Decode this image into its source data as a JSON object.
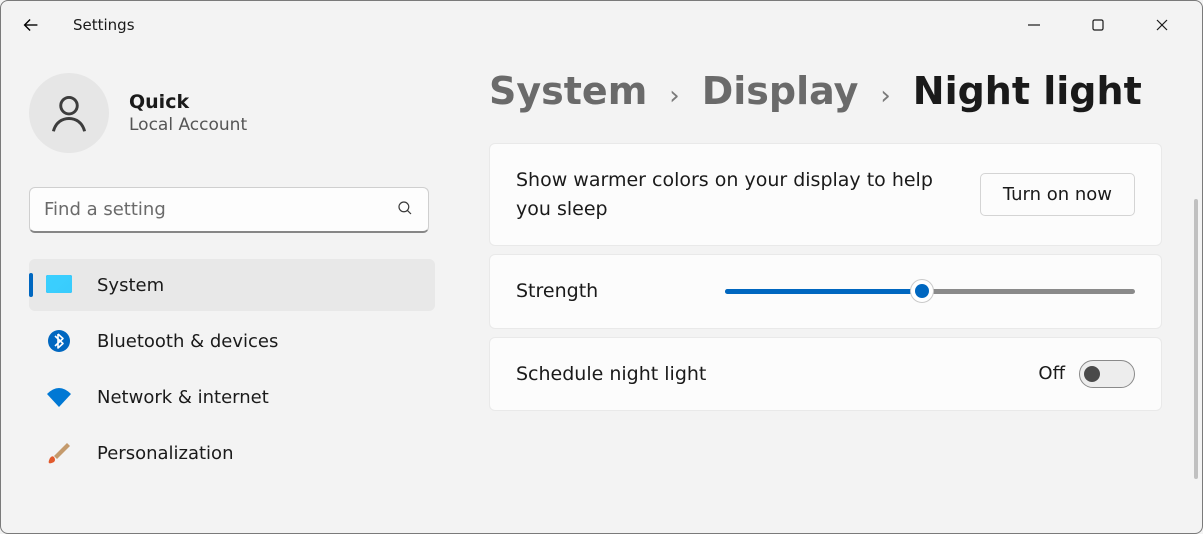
{
  "app_title": "Settings",
  "profile": {
    "name": "Quick",
    "subtitle": "Local Account"
  },
  "search": {
    "placeholder": "Find a setting"
  },
  "nav": {
    "items": [
      {
        "label": "System",
        "icon": "system"
      },
      {
        "label": "Bluetooth & devices",
        "icon": "bluetooth"
      },
      {
        "label": "Network & internet",
        "icon": "wifi"
      },
      {
        "label": "Personalization",
        "icon": "brush"
      }
    ],
    "selected_index": 0
  },
  "breadcrumb": {
    "crumbs": [
      "System",
      "Display"
    ],
    "current": "Night light"
  },
  "night_light": {
    "description": "Show warmer colors on your display to help you sleep",
    "button_label": "Turn on now",
    "strength_label": "Strength",
    "strength_percent": 48,
    "schedule_label": "Schedule night light",
    "schedule_state_label": "Off",
    "schedule_on": false
  },
  "colors": {
    "accent": "#0067c0"
  }
}
